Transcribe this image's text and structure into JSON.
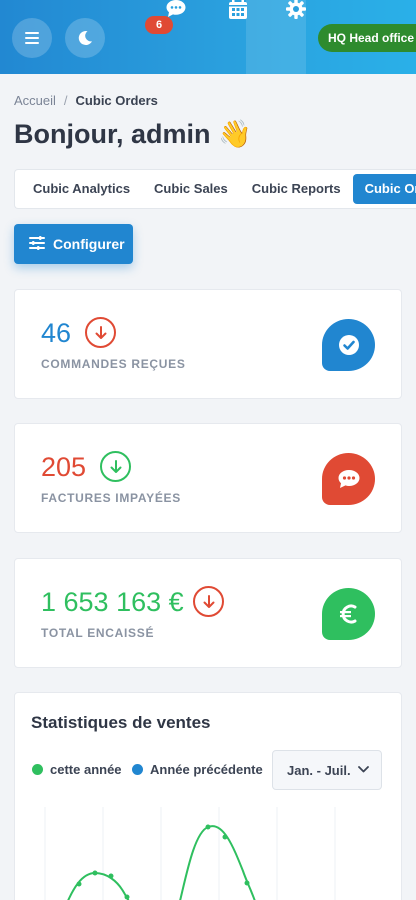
{
  "header": {
    "notification_count": "6",
    "location_badge": "HQ Head office",
    "colors": {
      "bar": "#2288d2",
      "badge": "#e04a34",
      "location": "#2e8b2e"
    },
    "icons": [
      "menu-icon",
      "moon-icon",
      "chat-icon",
      "calendar-icon",
      "gear-icon"
    ]
  },
  "breadcrumb": {
    "home": "Accueil",
    "separator": "/",
    "current": "Cubic Orders"
  },
  "greeting": "Bonjour, admin 👋",
  "tabs": [
    "Cubic Analytics",
    "Cubic Sales",
    "Cubic Reports",
    "Cubic Orders"
  ],
  "active_tab": "Cubic Orders",
  "configure_button": "Configurer",
  "stats": [
    {
      "value": "46",
      "label": "COMMANDES REÇUES",
      "trend": "down",
      "value_color": "#2186d0",
      "trend_color": "#e04a34",
      "icon": "check-icon",
      "icon_color": "#2186d0"
    },
    {
      "value": "205",
      "label": "FACTURES IMPAYÉES",
      "trend": "down",
      "value_color": "#e04a34",
      "trend_color": "#2fbf5f",
      "icon": "chat-dots-icon",
      "icon_color": "#e04a34"
    },
    {
      "value": "1 653 163 €",
      "label": "TOTAL ENCAISSÉ",
      "trend": "down",
      "value_color": "#2fbf5f",
      "trend_color": "#e04a34",
      "icon": "euro-icon",
      "icon_color": "#2fbf5f"
    }
  ],
  "sales": {
    "title": "Statistiques de ventes",
    "legend": [
      {
        "label": "cette année",
        "color": "#2fbf5f"
      },
      {
        "label": "Année précédente",
        "color": "#2186d0"
      }
    ],
    "period": "Jan. - Juil."
  }
}
